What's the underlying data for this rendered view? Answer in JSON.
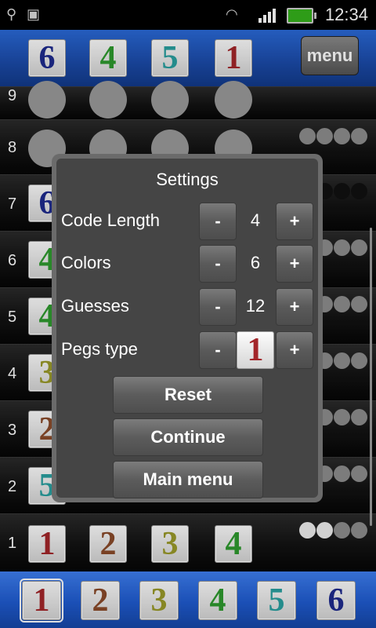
{
  "status_bar": {
    "time": "12:34"
  },
  "header": {
    "code_tiles": [
      {
        "label": "6",
        "color": "#1e2b8e"
      },
      {
        "label": "4",
        "color": "#2e9a2e"
      },
      {
        "label": "5",
        "color": "#2aa0a0"
      },
      {
        "label": "1",
        "color": "#a3262a"
      }
    ],
    "menu_label": "menu"
  },
  "board": {
    "row_numbers": [
      "9",
      "8",
      "7",
      "6",
      "5",
      "4",
      "3",
      "2",
      "1"
    ],
    "last_guess": [
      {
        "label": "1",
        "color": "#a3262a"
      },
      {
        "label": "2",
        "color": "#8a4a2a"
      },
      {
        "label": "3",
        "color": "#9a9a2a"
      },
      {
        "label": "4",
        "color": "#2e9a2e"
      }
    ],
    "partial_tile_labels": [
      "6",
      "4",
      "4",
      "3",
      "2",
      "5"
    ]
  },
  "settings": {
    "title": "Settings",
    "rows": [
      {
        "label": "Code Length",
        "value": "4"
      },
      {
        "label": "Colors",
        "value": "6"
      },
      {
        "label": "Guesses",
        "value": "12"
      },
      {
        "label": "Pegs type",
        "value": "1"
      }
    ],
    "minus_label": "-",
    "plus_label": "+",
    "buttons": {
      "reset": "Reset",
      "continue": "Continue",
      "main_menu": "Main menu"
    }
  },
  "palette": [
    {
      "label": "1",
      "color": "#a3262a",
      "selected": true
    },
    {
      "label": "2",
      "color": "#8a4a2a"
    },
    {
      "label": "3",
      "color": "#9a9a2a"
    },
    {
      "label": "4",
      "color": "#2e9a2e"
    },
    {
      "label": "5",
      "color": "#2aa0a0"
    },
    {
      "label": "6",
      "color": "#1e2b8e"
    }
  ]
}
